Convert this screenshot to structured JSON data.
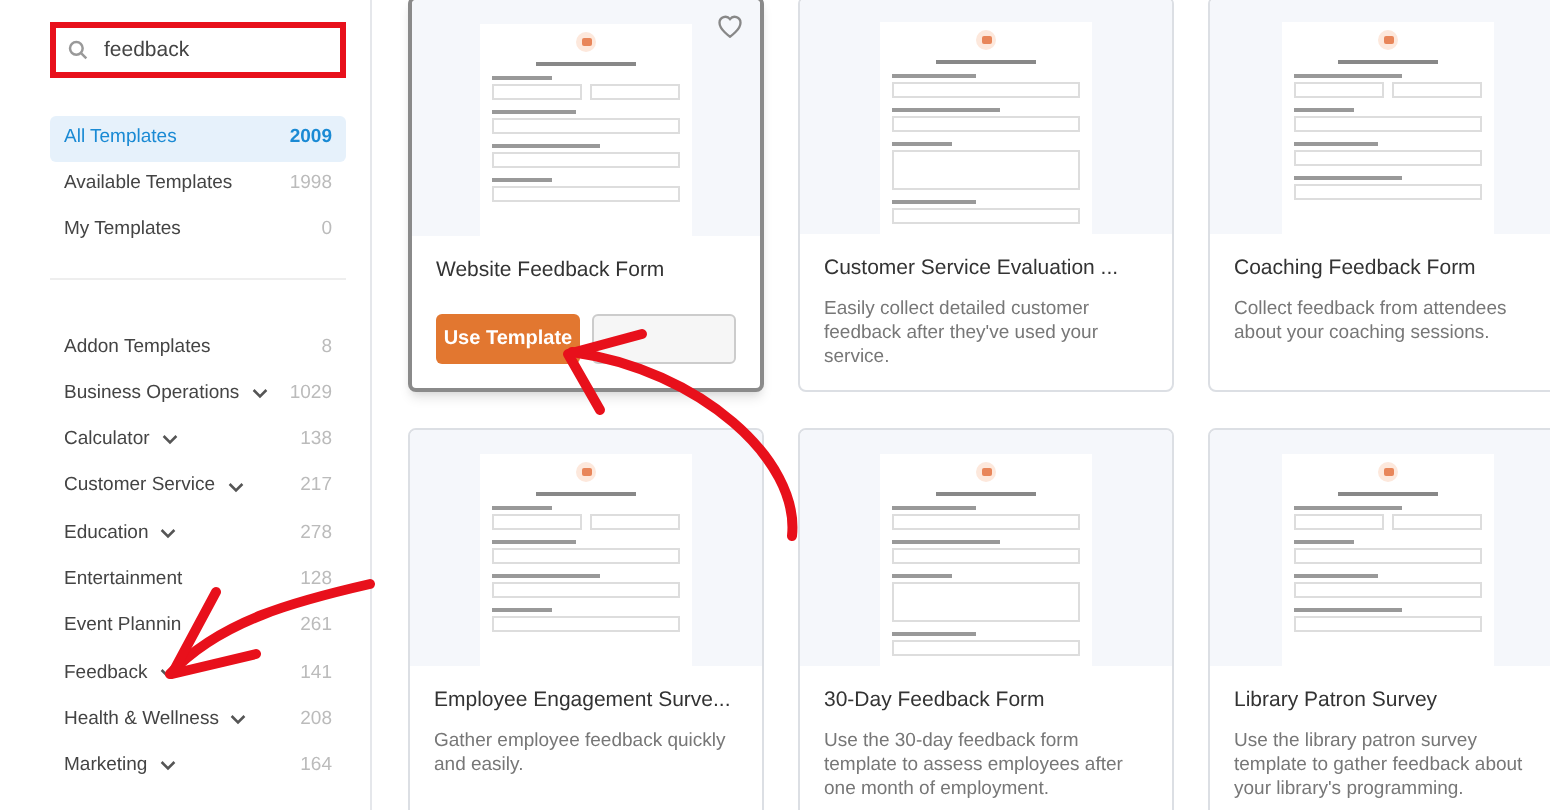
{
  "search": {
    "value": "feedback"
  },
  "filters": [
    {
      "label": "All Templates",
      "count": "2009",
      "selected": true
    },
    {
      "label": "Available Templates",
      "count": "1998",
      "selected": false
    },
    {
      "label": "My Templates",
      "count": "0",
      "selected": false
    }
  ],
  "categories": [
    {
      "label": "Addon Templates",
      "count": "8",
      "expandable": false
    },
    {
      "label": "Business Operations",
      "count": "1029",
      "expandable": true
    },
    {
      "label": "Calculator",
      "count": "138",
      "expandable": true
    },
    {
      "label": "Customer Service",
      "count": "217",
      "expandable": true
    },
    {
      "label": "Education",
      "count": "278",
      "expandable": true
    },
    {
      "label": "Entertainment",
      "count": "128",
      "expandable": false
    },
    {
      "label": "Event Plannin",
      "count": "261",
      "expandable": false
    },
    {
      "label": "Feedback",
      "count": "141",
      "expandable": true
    },
    {
      "label": "Health & Wellness",
      "count": "208",
      "expandable": true
    },
    {
      "label": "Marketing",
      "count": "164",
      "expandable": true
    }
  ],
  "templates": [
    {
      "title": "Website Feedback Form",
      "hovered": true,
      "primary_button": "Use Template"
    },
    {
      "title": "Customer Service Evaluation ...",
      "hovered": false,
      "description": "Easily collect detailed customer feedback after they've used your service."
    },
    {
      "title": "Coaching Feedback Form",
      "hovered": false,
      "description": "Collect feedback from attendees about your coaching sessions."
    },
    {
      "title": "Employee Engagement Surve...",
      "hovered": false,
      "description": "Gather employee feedback quickly and easily."
    },
    {
      "title": "30-Day Feedback Form",
      "hovered": false,
      "description": "Use the 30-day feedback form template to assess employees after one month of employment."
    },
    {
      "title": "Library Patron Survey",
      "hovered": false,
      "description": "Use the library patron survey template to gather feedback about your library's programming."
    }
  ]
}
